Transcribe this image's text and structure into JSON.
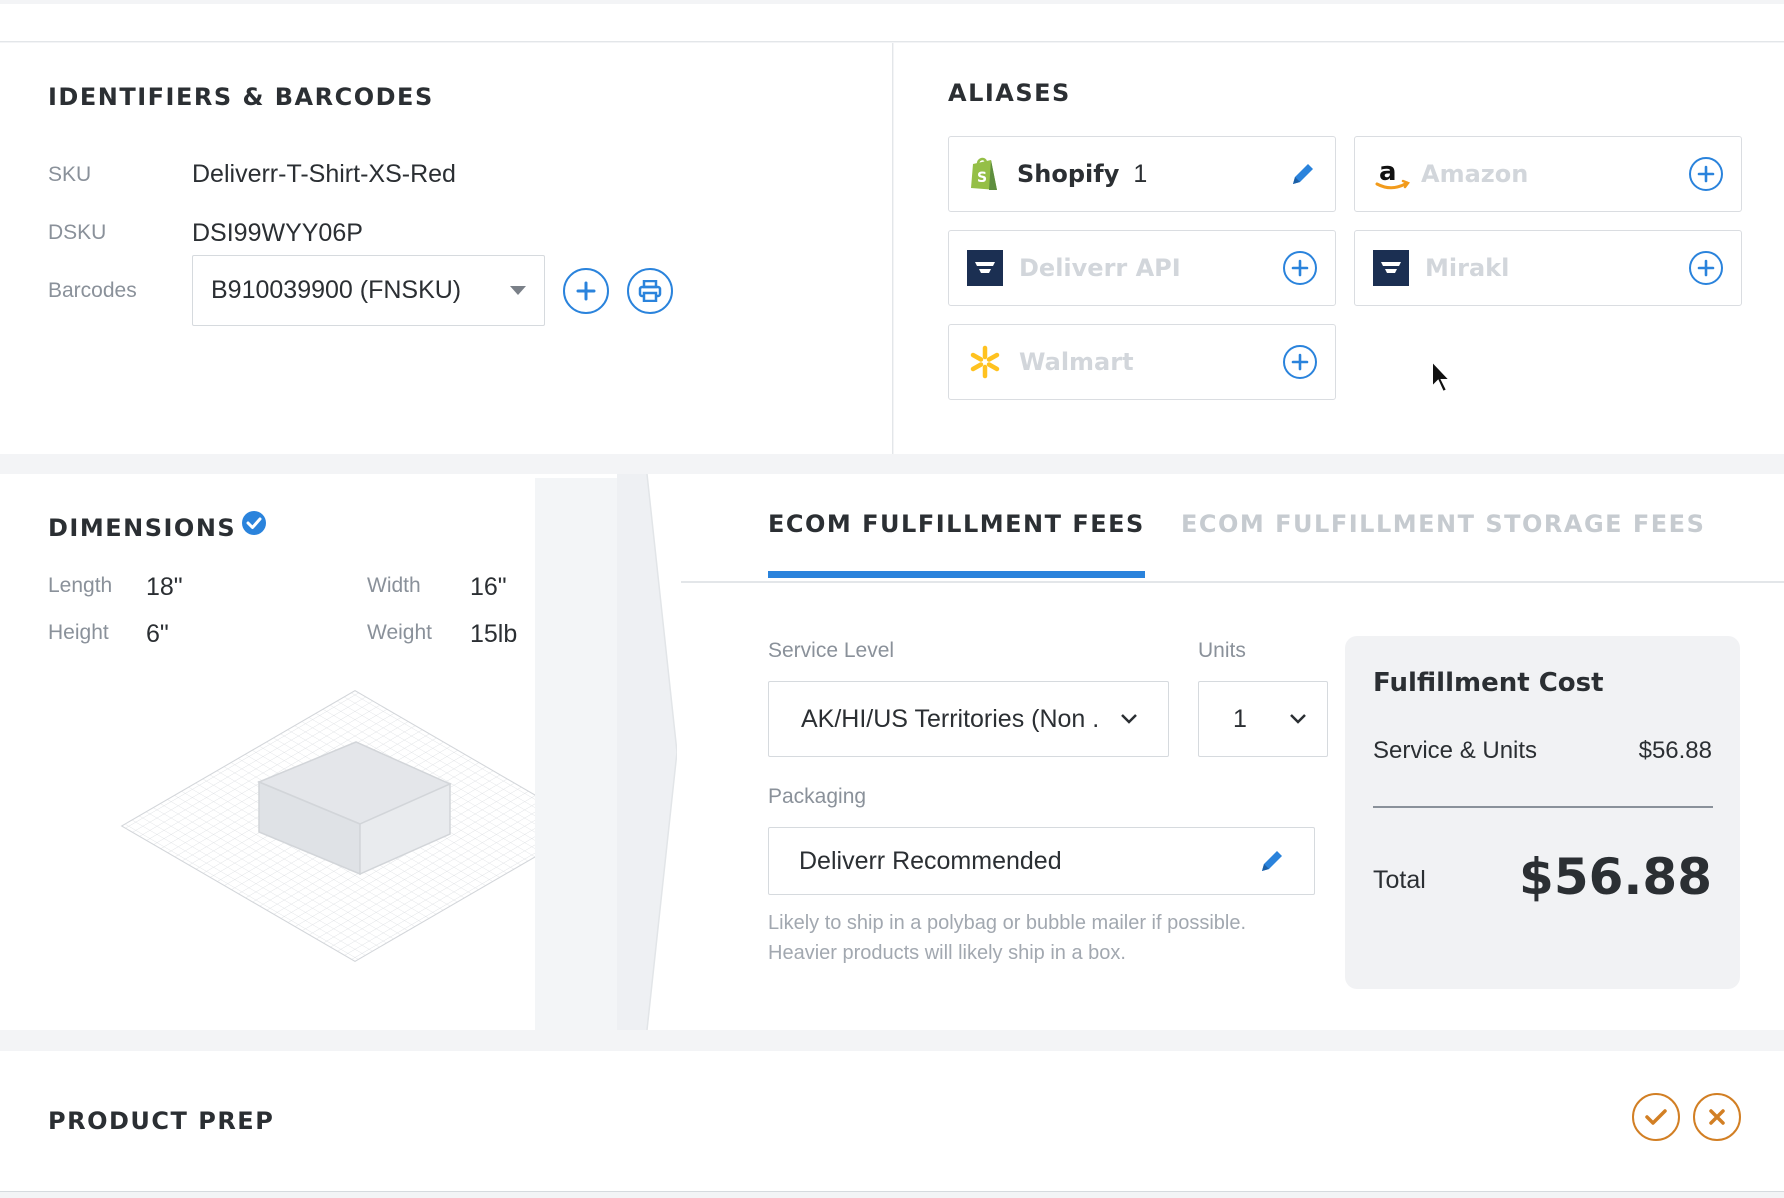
{
  "identifiers": {
    "title": "IDENTIFIERS & BARCODES",
    "sku_label": "SKU",
    "sku_value": "Deliverr-T-Shirt-XS-Red",
    "dsku_label": "DSKU",
    "dsku_value": "DSI99WYY06P",
    "barcodes_label": "Barcodes",
    "barcode_selected": "B910039900 (FNSKU)"
  },
  "aliases": {
    "title": "ALIASES",
    "items": [
      {
        "name": "Shopify",
        "count": "1",
        "active": true,
        "icon": "shopify-icon"
      },
      {
        "name": "Amazon",
        "active": false,
        "icon": "amazon-icon"
      },
      {
        "name": "Deliverr API",
        "active": false,
        "icon": "deliverr-icon"
      },
      {
        "name": "Mirakl",
        "active": false,
        "icon": "deliverr-icon"
      },
      {
        "name": "Walmart",
        "active": false,
        "icon": "walmart-icon"
      }
    ]
  },
  "dimensions": {
    "title": "DIMENSIONS",
    "length_label": "Length",
    "length_value": "18\"",
    "width_label": "Width",
    "width_value": "16\"",
    "height_label": "Height",
    "height_value": "6\"",
    "weight_label": "Weight",
    "weight_value": "15lb"
  },
  "fees": {
    "tabs": [
      {
        "label": "ECOM FULFILLMENT FEES",
        "active": true
      },
      {
        "label": "ECOM FULFILLMENT STORAGE FEES",
        "active": false
      }
    ],
    "service_level_label": "Service Level",
    "service_level_value": "AK/HI/US Territories (Non .",
    "units_label": "Units",
    "units_value": "1",
    "packaging_label": "Packaging",
    "packaging_value": "Deliverr Recommended",
    "packaging_note_1": "Likely to ship in a polybag or bubble mailer if possible.",
    "packaging_note_2": "Heavier products will likely ship in a box."
  },
  "cost": {
    "title": "Fulfillment Cost",
    "service_units_label": "Service & Units",
    "service_units_value": "$56.88",
    "total_label": "Total",
    "total_value": "$56.88"
  },
  "product_prep": {
    "title": "PRODUCT PREP"
  },
  "colors": {
    "accent": "#2a83dc",
    "warning": "#d27f24",
    "muted_text": "#8a919a"
  }
}
